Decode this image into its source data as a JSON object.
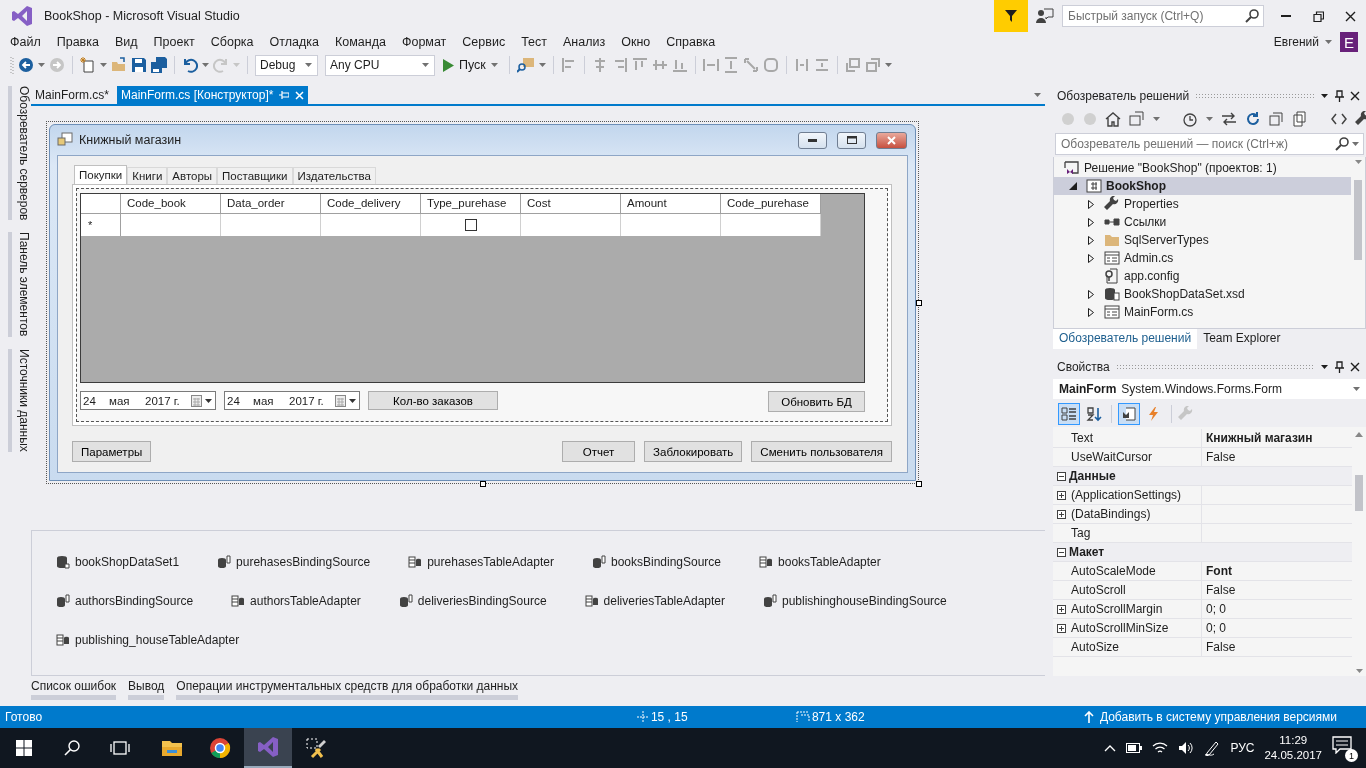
{
  "window": {
    "title": "BookShop - Microsoft Visual Studio"
  },
  "quick_launch": {
    "placeholder": "Быстрый запуск (Ctrl+Q)"
  },
  "menu": [
    "Файл",
    "Правка",
    "Вид",
    "Проект",
    "Сборка",
    "Отладка",
    "Команда",
    "Формат",
    "Сервис",
    "Тест",
    "Анализ",
    "Окно",
    "Справка"
  ],
  "account": {
    "name": "Евгений",
    "initial": "E"
  },
  "toolbar": {
    "configuration": "Debug",
    "platform": "Any CPU",
    "start": "Пуск"
  },
  "side_tabs": [
    "Обозреватель серверов",
    "Панель элементов",
    "Источники данных"
  ],
  "document_tabs": [
    {
      "label": "MainForm.cs*",
      "selected": false
    },
    {
      "label": "MainForm.cs [Конструктор]*",
      "selected": true
    }
  ],
  "form": {
    "title": "Книжный магазин",
    "tabs": [
      {
        "label": "Покупки",
        "selected": true
      },
      {
        "label": "Книги",
        "selected": false
      },
      {
        "label": "Авторы",
        "selected": false
      },
      {
        "label": "Поставщики",
        "selected": false
      },
      {
        "label": "Издательства",
        "selected": false
      }
    ],
    "grid": {
      "columns": [
        "Code_book",
        "Data_order",
        "Code_delivery",
        "Type_purehase",
        "Cost",
        "Amount",
        "Code_purehase"
      ],
      "new_row": {
        "marker": "*",
        "cells": [
          {
            "kind": "text"
          },
          {
            "kind": "text"
          },
          {
            "kind": "text"
          },
          {
            "kind": "checkbox",
            "checked": false
          },
          {
            "kind": "text"
          },
          {
            "kind": "text"
          },
          {
            "kind": "text"
          }
        ]
      }
    },
    "date_pickers": [
      {
        "day": "24",
        "month": "мая",
        "year": "2017 г."
      },
      {
        "day": "24",
        "month": "мая",
        "year": "2017 г."
      }
    ],
    "count_button": "Кол-во заказов",
    "refresh_button": "Обновить БД",
    "left_button": "Параметры",
    "buttons": [
      "Отчет",
      "Заблокировать",
      "Сменить пользователя"
    ]
  },
  "components": [
    {
      "name": "bookShopDataSet1",
      "kind": "dataset"
    },
    {
      "name": "purehasesBindingSource",
      "kind": "binding"
    },
    {
      "name": "purehasesTableAdapter",
      "kind": "adapter"
    },
    {
      "name": "booksBindingSource",
      "kind": "binding"
    },
    {
      "name": "booksTableAdapter",
      "kind": "adapter"
    },
    {
      "name": "authorsBindingSource",
      "kind": "binding"
    },
    {
      "name": "authorsTableAdapter",
      "kind": "adapter"
    },
    {
      "name": "deliveriesBindingSource",
      "kind": "binding"
    },
    {
      "name": "deliveriesTableAdapter",
      "kind": "adapter"
    },
    {
      "name": "publishinghouseBindingSource",
      "kind": "binding"
    },
    {
      "name": "publishing_houseTableAdapter",
      "kind": "adapter"
    }
  ],
  "solution_explorer": {
    "title": "Обозреватель решений",
    "search": {
      "placeholder": "Обозреватель решений — поиск (Ctrl+ж)"
    },
    "tree": [
      {
        "label": "Решение \"BookShop\"  (проектов: 1)",
        "kind": "solution",
        "selected": false,
        "children": [
          {
            "label": "BookShop",
            "kind": "project",
            "selected": true,
            "expandable": true,
            "expanded": true,
            "children": [
              {
                "label": "Properties",
                "kind": "properties",
                "selected": false,
                "expandable": true,
                "expanded": false
              },
              {
                "label": "Ссылки",
                "kind": "references",
                "selected": false,
                "expandable": true,
                "expanded": false
              },
              {
                "label": "SqlServerTypes",
                "kind": "folder",
                "selected": false,
                "expandable": true,
                "expanded": false
              },
              {
                "label": "Admin.cs",
                "kind": "code",
                "selected": false,
                "expandable": true,
                "expanded": false
              },
              {
                "label": "app.config",
                "kind": "config",
                "selected": false,
                "expandable": false
              },
              {
                "label": "BookShopDataSet.xsd",
                "kind": "dataset",
                "selected": false,
                "expandable": true,
                "expanded": false
              },
              {
                "label": "MainForm.cs",
                "kind": "code",
                "selected": false,
                "expandable": true,
                "expanded": false
              }
            ]
          }
        ]
      }
    ],
    "tabs": [
      {
        "label": "Обозреватель решений",
        "selected": true
      },
      {
        "label": "Team Explorer",
        "selected": false
      }
    ]
  },
  "properties": {
    "title": "Свойства",
    "object_name": "MainForm",
    "object_type": "System.Windows.Forms.Form",
    "toolbar": [
      {
        "kind": "categorized",
        "selected": true
      },
      {
        "kind": "alphabetical",
        "selected": false
      },
      {
        "kind": "properties",
        "selected": true
      },
      {
        "kind": "events",
        "selected": false
      }
    ],
    "rows": [
      {
        "kind": "property",
        "name": "Text",
        "value": "Книжный магазин",
        "changed": true
      },
      {
        "kind": "property",
        "name": "UseWaitCursor",
        "value": "False",
        "changed": false
      },
      {
        "kind": "category",
        "name": "Данные",
        "expanded": true
      },
      {
        "kind": "group",
        "name": "(ApplicationSettings)",
        "expanded": false
      },
      {
        "kind": "group",
        "name": "(DataBindings)",
        "expanded": false
      },
      {
        "kind": "property",
        "name": "Tag"
      },
      {
        "kind": "category",
        "name": "Макет",
        "expanded": true
      },
      {
        "kind": "property",
        "name": "AutoScaleMode",
        "value": "Font",
        "changed": true
      },
      {
        "kind": "property",
        "name": "AutoScroll",
        "value": "False",
        "changed": false
      },
      {
        "kind": "group",
        "name": "AutoScrollMargin",
        "value": "0; 0",
        "expanded": false,
        "changed": false
      },
      {
        "kind": "group",
        "name": "AutoScrollMinSize",
        "value": "0; 0",
        "expanded": false,
        "changed": false
      },
      {
        "kind": "property",
        "name": "AutoSize",
        "value": "False",
        "changed": false
      }
    ]
  },
  "output_tabs": [
    "Список ошибок",
    "Вывод",
    "Операции инструментальных средств для обработки данных"
  ],
  "status_bar": {
    "text": "Готово",
    "position": "15 , 15",
    "size": "871 x 362",
    "source_control": "Добавить в систему управления версиями"
  },
  "taskbar": {
    "apps": [
      {
        "kind": "explorer",
        "active": false
      },
      {
        "kind": "browser",
        "active": false
      },
      {
        "kind": "studio",
        "active": true
      },
      {
        "kind": "tool",
        "active": false
      }
    ],
    "language": "РУС",
    "time": "11:29",
    "date": "24.05.2017",
    "notifications": "1"
  }
}
